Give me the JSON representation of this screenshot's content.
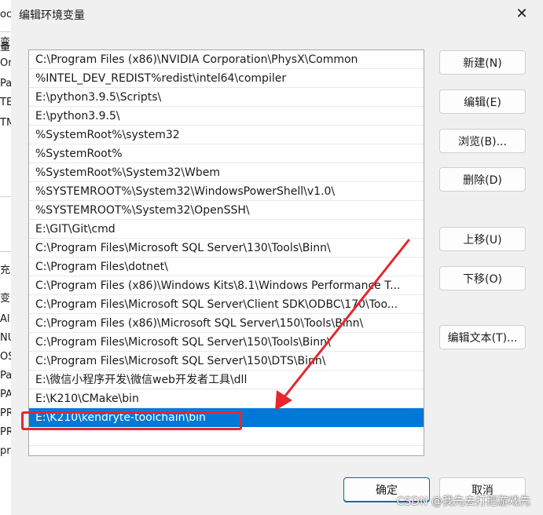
{
  "background_window": {
    "fragments": [
      "oc",
      "变",
      "Or",
      "Pa",
      "TE",
      "TM",
      "量",
      "充",
      "变",
      "Al",
      "NU",
      "OS",
      "Pa",
      "PA",
      "PR",
      "PR",
      "pr"
    ]
  },
  "dialog": {
    "title": "编辑环境变量",
    "close_glyph": "✕"
  },
  "path_list": {
    "items": [
      "C:\\Program Files (x86)\\NVIDIA Corporation\\PhysX\\Common",
      "%INTEL_DEV_REDIST%redist\\intel64\\compiler",
      "E:\\python3.9.5\\Scripts\\",
      "E:\\python3.9.5\\",
      "%SystemRoot%\\system32",
      "%SystemRoot%",
      "%SystemRoot%\\System32\\Wbem",
      "%SYSTEMROOT%\\System32\\WindowsPowerShell\\v1.0\\",
      "%SYSTEMROOT%\\System32\\OpenSSH\\",
      "E:\\GIT\\Git\\cmd",
      "C:\\Program Files\\Microsoft SQL Server\\130\\Tools\\Binn\\",
      "C:\\Program Files\\dotnet\\",
      "C:\\Program Files (x86)\\Windows Kits\\8.1\\Windows Performance T...",
      "C:\\Program Files\\Microsoft SQL Server\\Client SDK\\ODBC\\170\\Too...",
      "C:\\Program Files (x86)\\Microsoft SQL Server\\150\\Tools\\Binn\\",
      "C:\\Program Files\\Microsoft SQL Server\\150\\Tools\\Binn\\",
      "C:\\Program Files\\Microsoft SQL Server\\150\\DTS\\Binn\\",
      "E:\\微信小程序开发\\微信web开发者工具\\dll",
      "E:\\K210\\CMake\\bin",
      "E:\\K210\\kendryte-toolchain\\bin",
      ""
    ],
    "selected_index": 19
  },
  "buttons": {
    "new": "新建(N)",
    "edit": "编辑(E)",
    "browse": "浏览(B)...",
    "delete": "删除(D)",
    "move_up": "上移(U)",
    "move_down": "下移(O)",
    "edit_text": "编辑文本(T)...",
    "ok": "确定",
    "cancel": "取消"
  },
  "watermark": "CSDN @我先去打把游戏先",
  "colors": {
    "selection": "#0078d7",
    "annotation": "#e8262b"
  }
}
